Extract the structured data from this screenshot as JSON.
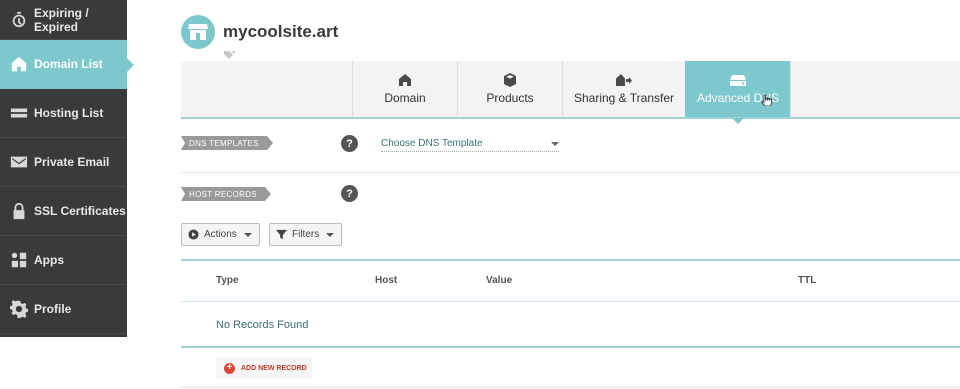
{
  "sidebar": {
    "items": [
      {
        "label": "Expiring / Expired",
        "icon": "stopwatch-icon"
      },
      {
        "label": "Domain List",
        "icon": "home-icon"
      },
      {
        "label": "Hosting List",
        "icon": "server-icon"
      },
      {
        "label": "Private Email",
        "icon": "envelope-icon"
      },
      {
        "label": "SSL Certificates",
        "icon": "lock-icon"
      },
      {
        "label": "Apps",
        "icon": "apps-icon"
      },
      {
        "label": "Profile",
        "icon": "gear-icon"
      }
    ],
    "active_index": 1
  },
  "header": {
    "site_name": "mycoolsite.art",
    "avatar_icon": "storefront-icon",
    "tag_icon": "tag-add-icon"
  },
  "tabs": [
    {
      "label": "Domain",
      "icon": "home-icon"
    },
    {
      "label": "Products",
      "icon": "box-icon"
    },
    {
      "label": "Sharing & Transfer",
      "icon": "share-transfer-icon"
    },
    {
      "label": "Advanced DNS",
      "icon": "dns-server-icon"
    }
  ],
  "active_tab": "Advanced DNS",
  "dns_templates": {
    "section_label": "DNS TEMPLATES",
    "help": "?",
    "select_value": "Choose DNS Template"
  },
  "host_records": {
    "section_label": "HOST RECORDS",
    "help": "?",
    "actions_label": "Actions",
    "filters_label": "Filters",
    "columns": [
      "Type",
      "Host",
      "Value",
      "TTL"
    ],
    "empty_message": "No Records Found",
    "add_label": "ADD NEW RECORD"
  },
  "colors": {
    "accent": "#7cc8cc",
    "sidebar_bg": "#3a3a3a",
    "add_red": "#e0473a"
  }
}
